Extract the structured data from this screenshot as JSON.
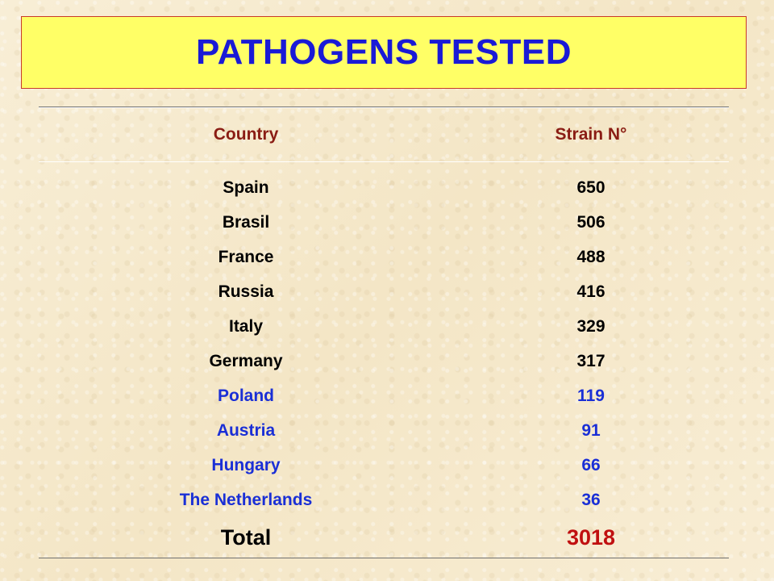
{
  "title": "PATHOGENS TESTED",
  "table": {
    "headers": {
      "country": "Country",
      "strain": "Strain N°"
    },
    "rows": [
      {
        "country": "Spain",
        "strain": "650",
        "highlight": false
      },
      {
        "country": "Brasil",
        "strain": "506",
        "highlight": false
      },
      {
        "country": "France",
        "strain": "488",
        "highlight": false
      },
      {
        "country": "Russia",
        "strain": "416",
        "highlight": false
      },
      {
        "country": "Italy",
        "strain": "329",
        "highlight": false
      },
      {
        "country": "Germany",
        "strain": "317",
        "highlight": false
      },
      {
        "country": "Poland",
        "strain": "119",
        "highlight": true
      },
      {
        "country": "Austria",
        "strain": "91",
        "highlight": true
      },
      {
        "country": "Hungary",
        "strain": "66",
        "highlight": true
      },
      {
        "country": "The Netherlands",
        "strain": "36",
        "highlight": true
      }
    ],
    "total": {
      "label": "Total",
      "value": "3018"
    }
  },
  "colors": {
    "title_text": "#1a1ad6",
    "title_background": "#ffff66",
    "header_text": "#8a1c14",
    "highlight_text": "#1a2fd6",
    "total_value": "#c01010"
  }
}
